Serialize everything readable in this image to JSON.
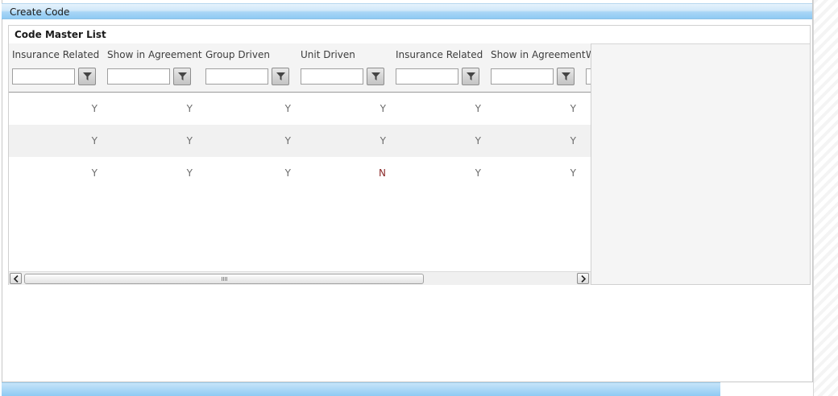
{
  "window": {
    "title": "Create Code"
  },
  "panel": {
    "title": "Code Master List"
  },
  "grid": {
    "columns": [
      "Insurance Related",
      "Show in Agreement",
      "Group Driven",
      "Unit Driven",
      "Insurance Related",
      "Show in Agreement",
      "W"
    ],
    "rows": [
      [
        "Y",
        "Y",
        "Y",
        "Y",
        "Y",
        "Y"
      ],
      [
        "Y",
        "Y",
        "Y",
        "Y",
        "Y",
        "Y"
      ],
      [
        "Y",
        "Y",
        "Y",
        "N",
        "Y",
        "Y"
      ]
    ]
  },
  "icons": {
    "filter": "filter-funnel-icon",
    "scroll_left": "arrow-left-icon",
    "scroll_right": "arrow-right-icon"
  },
  "colors": {
    "title_bar": "#8fcaf3",
    "no_value": "#8b2a2a"
  }
}
